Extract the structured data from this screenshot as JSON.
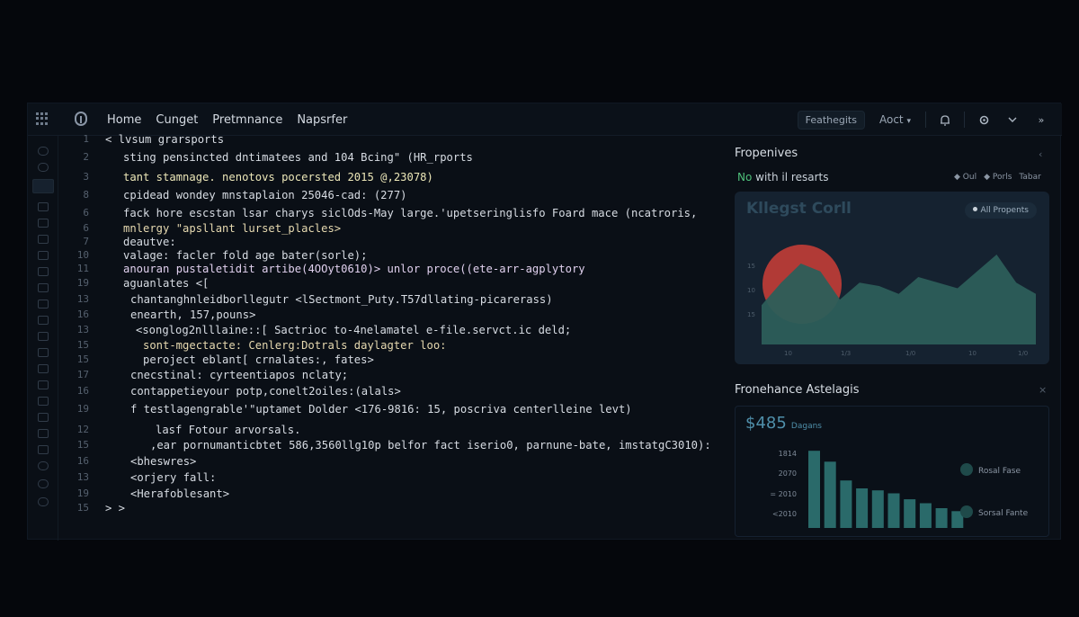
{
  "nav": {
    "items": [
      "Home",
      "Cunget",
      "Pretmnance",
      "Napsrfer"
    ],
    "search_button": "Feathegits",
    "account": "Aoct"
  },
  "code_lines": [
    {
      "n": "1",
      "indent": 26,
      "text": "< lvsum grarsports",
      "color": "#d7dce3"
    },
    {
      "n": "2",
      "indent": 46,
      "text": "sting pensincted dntimatees and 104 Bcing\" (HR_rports",
      "color": "#d7dce3"
    },
    {
      "n": "3",
      "indent": 46,
      "text": "tant stamnage. nenotovs pocersted 2015 @,23078)",
      "color": "#ece7b8"
    },
    {
      "n": "8",
      "indent": 46,
      "text": "cpidead wondey mnstaplaion 25046-cad: (277)",
      "color": "#d7dce3"
    },
    {
      "n": "6",
      "indent": 46,
      "text": "fack hore escstan lsar charys siclOds-May large.'upetseringlisfo Foard mace (ncatroris,",
      "color": "#d7dce3"
    },
    {
      "n": "6",
      "indent": 46,
      "text": "mnlergy \"apsllant lurset_placles>",
      "color": "#e6d9b0"
    },
    {
      "n": "7",
      "indent": 46,
      "text": "deautve:",
      "color": "#d7dce3"
    },
    {
      "n": "10",
      "indent": 46,
      "text": "valage: facler fold age bater(sorle);",
      "color": "#d7dce3"
    },
    {
      "n": "11",
      "indent": 46,
      "text": "anouran pustaletidit artibe(4OOyt0610)> unlor proce((ete-arr-agplytory",
      "color": "#e0d0ee"
    },
    {
      "n": "19",
      "indent": 46,
      "text": "aguanlates <[",
      "color": "#d7dce3"
    },
    {
      "n": "13",
      "indent": 54,
      "text": "chantanghnleidborllegutr <lSectmont_Puty.T57dllating-picarerass)",
      "color": "#d7dce3"
    },
    {
      "n": "16",
      "indent": 54,
      "text": "enearth, 157,pouns>",
      "color": "#d7dce3"
    },
    {
      "n": "13",
      "indent": 60,
      "text": "<songlog2nlllaine::[ Sactrioc to-4nelamatel e-file.servct.ic deld;",
      "color": "#d7dce3"
    },
    {
      "n": "15",
      "indent": 68,
      "text": "sont-mgectacte: Cenlerg:Dotrals daylagter loo:",
      "color": "#e6d9b0"
    },
    {
      "n": "15",
      "indent": 68,
      "text": "peroject eblant[ crnalates:, fates>",
      "color": "#d7dce3"
    },
    {
      "n": "17",
      "indent": 54,
      "text": "cnecstinal: cyrteentiapos nclaty;",
      "color": "#d7dce3"
    },
    {
      "n": "16",
      "indent": 54,
      "text": "contappetieyour potp,conelt2oiles:(alals>",
      "color": "#d7dce3"
    },
    {
      "n": "19",
      "indent": 54,
      "text": "f testlagengrable'\"uptamet Dolder <176-9816: 15, poscriva centerlleine levt)",
      "color": "#d7dce3"
    },
    {
      "n": "12",
      "indent": 82,
      "text": "lasf Fotour arvorsals.",
      "color": "#d7dce3"
    },
    {
      "n": "15",
      "indent": 76,
      "text": ",ear pornumanticbtet 586,3560llg10p belfor fact iserio0, parnune-bate, imstatgC3010):",
      "color": "#d7dce3"
    },
    {
      "n": "16",
      "indent": 54,
      "text": "<bheswres>",
      "color": "#d7dce3"
    },
    {
      "n": "13",
      "indent": 54,
      "text": "<orjery fall:",
      "color": "#d7dce3"
    },
    {
      "n": "19",
      "indent": 54,
      "text": "<Herafoblesant>",
      "color": "#d7dce3"
    },
    {
      "n": "15",
      "indent": 26,
      "text": "> >",
      "color": "#d7dce3"
    }
  ],
  "panel1": {
    "title": "Fropenives",
    "subtitle_highlight": "No",
    "subtitle": "with il resarts",
    "link1": "Oul",
    "link2": "Porls",
    "link3": "Tabar",
    "card_title": "Kllegst Corll",
    "chip": "All Propents"
  },
  "panel2": {
    "title": "Fronehance Astelagis",
    "value": "$485",
    "value_suffix": "Dagans",
    "legend1": "Rosal Fase",
    "legend2": "Sorsal Fante"
  },
  "chart_data": [
    {
      "type": "area",
      "title": "Kllegst Corll",
      "x_ticks": [
        "10",
        "1/3",
        "1/0",
        "10",
        "1/0"
      ],
      "y_ticks": [
        "15",
        "10",
        "15"
      ],
      "values": [
        0.35,
        0.55,
        0.72,
        0.65,
        0.4,
        0.55,
        0.52,
        0.45,
        0.6,
        0.55,
        0.5,
        0.65,
        0.8,
        0.55,
        0.45
      ],
      "ylim": [
        0,
        1
      ],
      "grid": false
    },
    {
      "type": "bar",
      "y_ticks": [
        "1814",
        "2070",
        "= 2010",
        "<2010"
      ],
      "values": [
        0.78,
        0.67,
        0.48,
        0.4,
        0.38,
        0.35,
        0.29,
        0.25,
        0.2,
        0.17
      ],
      "ylim": [
        0,
        1
      ]
    }
  ],
  "colors": {
    "accent_green": "#4ec07a",
    "area_fill": "#2c5e5a",
    "bar": "#2a6a6a",
    "sun": "#b13a36"
  }
}
